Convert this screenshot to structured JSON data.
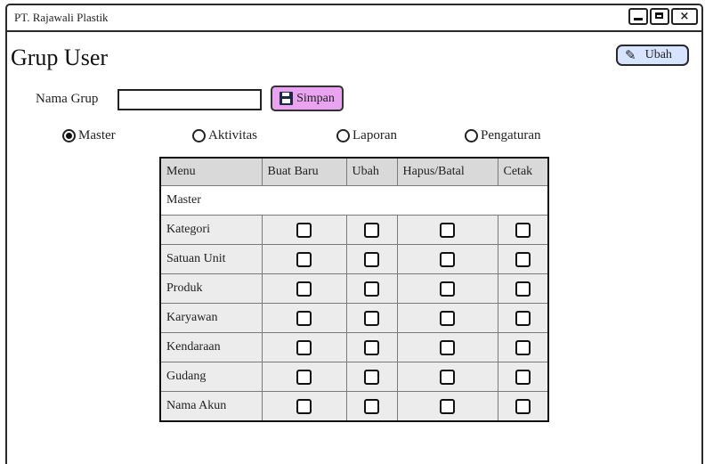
{
  "window": {
    "title": "PT. Rajawali Plastik",
    "close_label": "×"
  },
  "header": {
    "page_title": "Grup User",
    "edit_button": "Ubah"
  },
  "form": {
    "name_label": "Nama Grup",
    "name_value": "",
    "save_button": "Simpan"
  },
  "tabs": [
    {
      "label": "Master",
      "selected": true
    },
    {
      "label": "Aktivitas",
      "selected": false
    },
    {
      "label": "Laporan",
      "selected": false
    },
    {
      "label": "Pengaturan",
      "selected": false
    }
  ],
  "table": {
    "columns": [
      "Menu",
      "Buat Baru",
      "Ubah",
      "Hapus/Batal",
      "Cetak"
    ],
    "section": "Master",
    "rows": [
      {
        "menu": "Kategori",
        "checks": [
          false,
          false,
          false,
          false
        ]
      },
      {
        "menu": "Satuan Unit",
        "checks": [
          false,
          false,
          false,
          false
        ]
      },
      {
        "menu": "Produk",
        "checks": [
          false,
          false,
          false,
          false
        ]
      },
      {
        "menu": "Karyawan",
        "checks": [
          false,
          false,
          false,
          false
        ]
      },
      {
        "menu": "Kendaraan",
        "checks": [
          false,
          false,
          false,
          false
        ]
      },
      {
        "menu": "Gudang",
        "checks": [
          false,
          false,
          false,
          false
        ]
      },
      {
        "menu": "Nama Akun",
        "checks": [
          false,
          false,
          false,
          false
        ]
      }
    ]
  },
  "colors": {
    "save_button_bg": "#e9a3f0",
    "edit_button_bg": "#d6e4ff",
    "header_bg": "#d9d9d9",
    "row_bg": "#ececec"
  }
}
